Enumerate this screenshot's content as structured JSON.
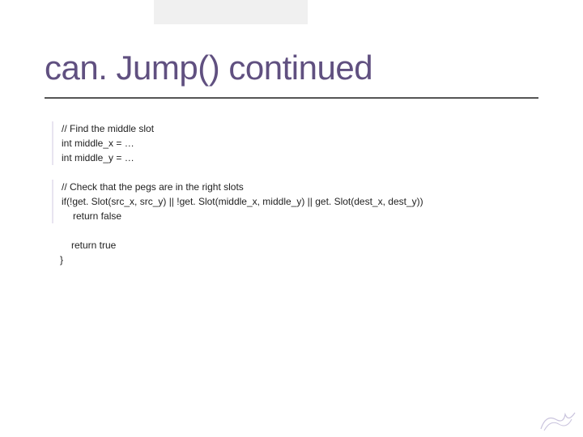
{
  "slide": {
    "title": "can. Jump() continued"
  },
  "code": {
    "block1": {
      "l1": "// Find the middle slot",
      "l2": "int middle_x = …",
      "l3": "int middle_y = …"
    },
    "block2": {
      "l1": "// Check that the pegs are in the right slots",
      "l2": "if(!get. Slot(src_x, src_y) || !get. Slot(middle_x, middle_y) || get. Slot(dest_x, dest_y))",
      "l3": "return false"
    },
    "block3": {
      "l1": "return true",
      "l2": "}"
    }
  }
}
